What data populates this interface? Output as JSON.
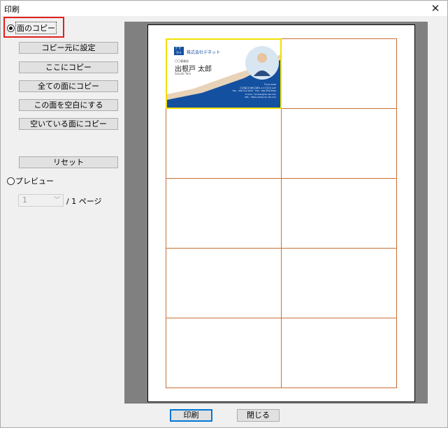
{
  "window": {
    "title": "印刷"
  },
  "left_panel": {
    "copy_radio_label": "面のコピー",
    "buttons": {
      "set_copy_source": "コピー元に設定",
      "copy_here": "ここにコピー",
      "copy_all": "全ての面にコピー",
      "clear_face": "この面を空白にする",
      "copy_to_empty": "空いている面にコピー",
      "reset": "リセット"
    },
    "preview_radio_label": "プレビュー",
    "page_select_value": "1",
    "page_total": "/ 1 ページ"
  },
  "card": {
    "logo": "ﾃﾞｻﾞ ﾈｯﾄ",
    "company": "株式会社デネット",
    "department": "〇〇事業部",
    "name": "出根戸 太郎",
    "name_roman": "Sasuto Taro",
    "info_lines": [
      "〒012-3456",
      "〇〇県〇〇市〇〇町1-2-3 〇〇ビル4F",
      "TEL：000-111-2222　FAX：000-333-4444",
      "E-mail：tarosan@de-net.com",
      "URL：https://www.de-net.com"
    ]
  },
  "bottom_buttons": {
    "print": "印刷",
    "close": "閉じる"
  },
  "colors": {
    "highlight": "#e0201c",
    "grid_line": "#c87034",
    "selected_card_border": "#f0e000",
    "card_blue": "#1450a0",
    "preview_bg": "#808080"
  }
}
